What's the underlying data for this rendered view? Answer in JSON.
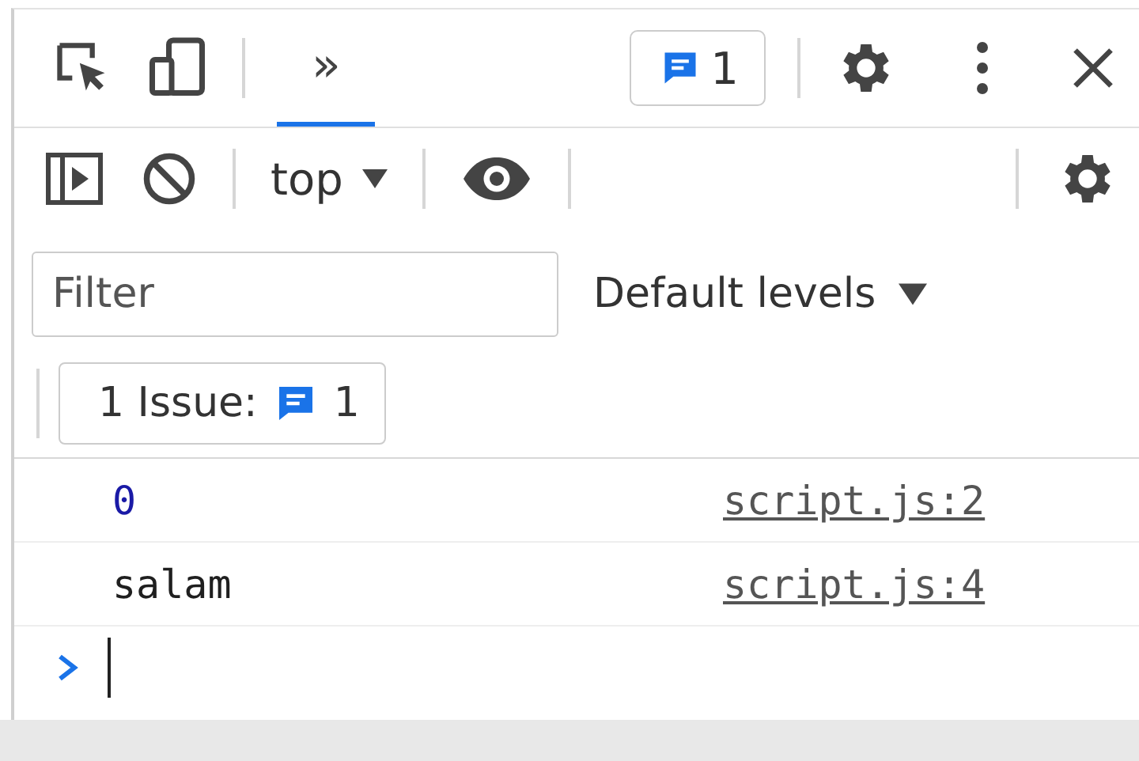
{
  "main_toolbar": {
    "tabs": [
      {
        "label": "»",
        "selected": true
      }
    ],
    "messages_count": "1"
  },
  "console_toolbar": {
    "context": "top"
  },
  "filter": {
    "placeholder": "Filter",
    "levels": "Default levels"
  },
  "issues": {
    "label": "1 Issue:",
    "count": "1"
  },
  "messages": [
    {
      "kind": "number",
      "text": "0",
      "source": "script.js:2"
    },
    {
      "kind": "string",
      "text": "salam",
      "source": "script.js:4"
    }
  ]
}
